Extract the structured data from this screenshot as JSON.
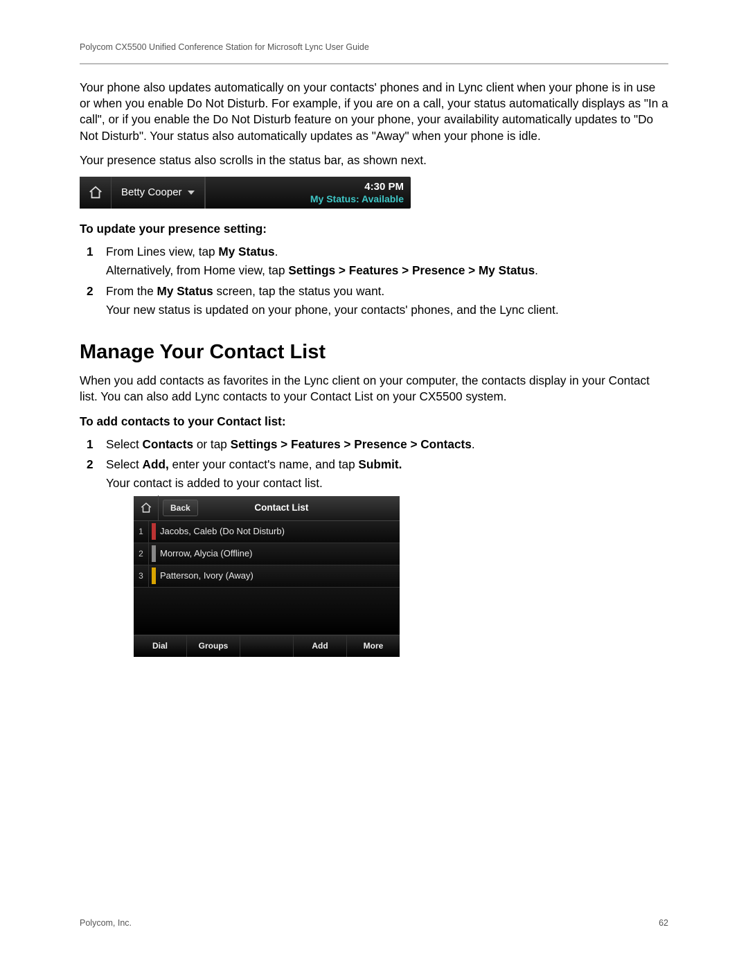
{
  "header": "Polycom CX5500 Unified Conference Station for Microsoft Lync User Guide",
  "para1": "Your phone also updates automatically on your contacts' phones and in Lync client when your phone is in use or when you enable Do Not Disturb. For example, if you are on a call, your status automatically displays as \"In a call\", or if you enable the Do Not Disturb feature on your phone, your availability automatically updates to \"Do Not Disturb\". Your status also automatically updates as \"Away\" when your phone is idle.",
  "para2": "Your presence status also scrolls in the status bar, as shown next.",
  "statusbar": {
    "name": "Betty Cooper",
    "time": "4:30 PM",
    "status": "My Status: Available"
  },
  "proc1": {
    "title": "To update your presence setting:",
    "s1a": "From Lines view, tap ",
    "s1b": "My Status",
    "s1c": ".",
    "s1alt_a": "Alternatively, from Home view, tap ",
    "s1alt_b": "Settings > Features > Presence > My Status",
    "s1alt_c": ".",
    "s2a": "From the ",
    "s2b": "My Status",
    "s2c": " screen, tap the status you want.",
    "s2res": "Your new status is updated on your phone, your contacts' phones, and the Lync client."
  },
  "h2": "Manage Your Contact List",
  "para3": "When you add contacts as favorites in the Lync client on your computer, the contacts display in your Contact list. You can also add Lync contacts to your Contact List on your CX5500 system.",
  "proc2": {
    "title": "To add contacts to your Contact list:",
    "s1a": "Select ",
    "s1b": "Contacts",
    "s1c": " or tap ",
    "s1d": "Settings > Features > Presence > Contacts",
    "s1e": ".",
    "s2a": "Select ",
    "s2b": "Add,",
    "s2c": " enter your contact's name, and tap ",
    "s2d": "Submit.",
    "s2res": "Your contact is added to your contact list."
  },
  "contactlist": {
    "back": "Back",
    "title": "Contact List",
    "rows": [
      {
        "n": "1",
        "name": "Jacobs, Caleb (Do Not Disturb)"
      },
      {
        "n": "2",
        "name": "Morrow, Alycia (Offline)"
      },
      {
        "n": "3",
        "name": "Patterson, Ivory (Away)"
      }
    ],
    "footer": [
      "Dial",
      "Groups",
      "",
      "Add",
      "More"
    ]
  },
  "footer": {
    "left": "Polycom, Inc.",
    "right": "62"
  }
}
